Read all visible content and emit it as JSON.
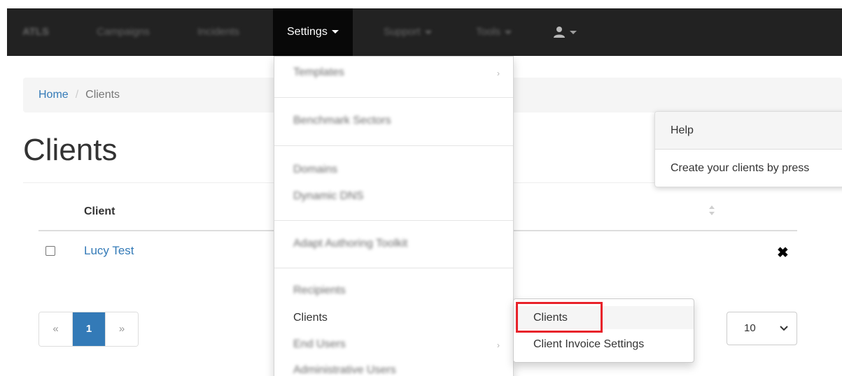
{
  "navbar": {
    "brand": "ATLS",
    "items": [
      "Campaigns",
      "Incidents"
    ],
    "active_menu": "Settings",
    "right_items": [
      "Support",
      "Tools"
    ],
    "user_icon": "user-icon"
  },
  "breadcrumb": {
    "home": "Home",
    "separator": "/",
    "current": "Clients"
  },
  "page_title": "Clients",
  "table": {
    "column_client": "Client",
    "rows": [
      {
        "name": "Lucy Test"
      }
    ],
    "delete_glyph": "✖"
  },
  "pagination": {
    "prev": "«",
    "current": "1",
    "next": "»"
  },
  "page_size": {
    "value": "10"
  },
  "help": {
    "title": "Help",
    "text": "Create your clients by press"
  },
  "settings_menu": {
    "items": [
      "Templates",
      "Benchmark Sectors",
      "Domains",
      "Dynamic DNS",
      "Adapt Authoring Toolkit",
      "Recipients",
      "Clients",
      "End Users",
      "Administrative Users"
    ]
  },
  "clients_submenu": {
    "items": [
      "Clients",
      "Client Invoice Settings"
    ]
  },
  "colors": {
    "navbar": "#222222",
    "link": "#337ab7",
    "highlight": "#e8222a"
  }
}
